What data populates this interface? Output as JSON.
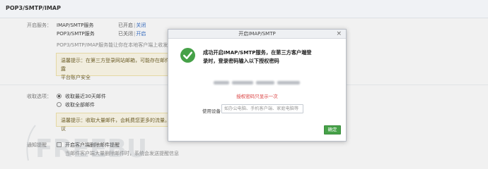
{
  "page": {
    "title": "POP3/SMTP/IMAP"
  },
  "settings": {
    "service_label": "开启服务：",
    "services": [
      {
        "name": "IMAP/SMTP服务",
        "status": "已开启",
        "sep": "|",
        "action": "关闭"
      },
      {
        "name": "POP3/SMTP服务",
        "status": "已关闭",
        "sep": "|",
        "action": "开启"
      }
    ],
    "description": "POP3/SMTP/IMAP服务能让你在本地客户端上收发邮件，",
    "tip1_line1": "温馨提示：在第三方登录网站邮箱，可能存在邮件泄露",
    "tip1_line2": "平台账户安全",
    "receive_label": "收取选项：",
    "receive_options": [
      "收取最近30天邮件",
      "收取全部邮件"
    ],
    "tip2": "温馨提示：收取大量邮件，会耗费您更多的流量。建议",
    "notify_label": "通知提醒",
    "notify_checkbox": "开启客户端删除邮件提醒",
    "notify_desc": "当邮件客户端大量删除邮件时，系统会发送提醒信息",
    "watermark": "FREEBUF"
  },
  "dialog": {
    "title": "开启IMAP/SMTP",
    "close_glyph": "×",
    "icon": "success-check-icon",
    "message_line1": "成功开启IMAP/SMTP服务，在第三方客户端登",
    "message_line2": "录时，登录密码输入以下授权密码",
    "code_hint": "授权密码只显示一次",
    "device_label": "使用设备",
    "device_placeholder": "如办公电脑、手机客户端、家庭电脑等",
    "confirm_label": "确定"
  },
  "colors": {
    "accent_green": "#46a148",
    "link_blue": "#2a66c4",
    "warning_red": "#d93b3b",
    "tip_bg": "#fffbea"
  }
}
